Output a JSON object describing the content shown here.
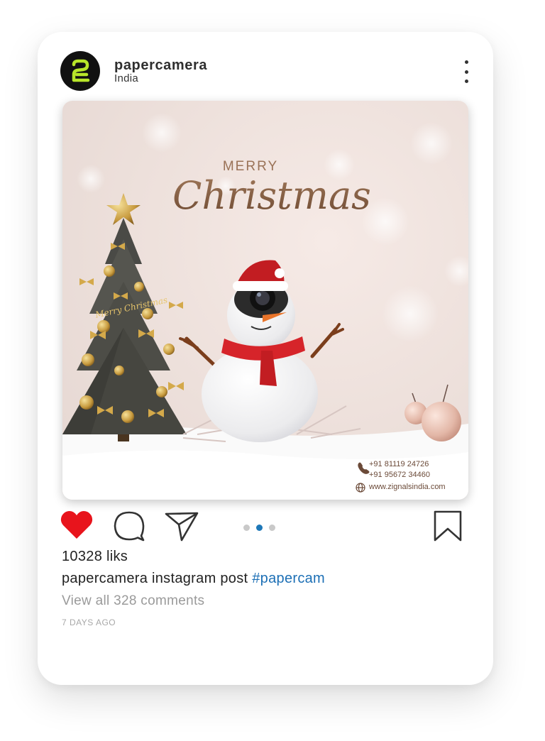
{
  "post": {
    "username": "papercamera",
    "location": "India",
    "greeting_top": "MERRY",
    "greeting_main": "Christmas",
    "tree_card_text": "Merry Christmas",
    "contact": {
      "phone1": "+91 81119 24726",
      "phone2": "+91 95672 34460",
      "website": "www.zignalsindia.com"
    },
    "carousel": {
      "count": 3,
      "active_index": 1
    },
    "likes": "10328 liks",
    "caption_user": "papercamera",
    "caption_text": "instagram post",
    "hashtag": "#papercam",
    "comments_link": "View all 328 comments",
    "timestamp": "7 DAYS AGO"
  },
  "icons": {
    "avatar": "papercamera-logo-icon",
    "more": "more-vertical-icon",
    "like": "heart-icon",
    "comment": "comment-icon",
    "share": "send-icon",
    "save": "bookmark-icon",
    "phone": "phone-icon",
    "web": "globe-icon"
  },
  "colors": {
    "like": "#e8141c",
    "hashtag": "#1c6fb5",
    "carousel_active": "#1e78b8",
    "logo_green": "#b8e62a"
  }
}
